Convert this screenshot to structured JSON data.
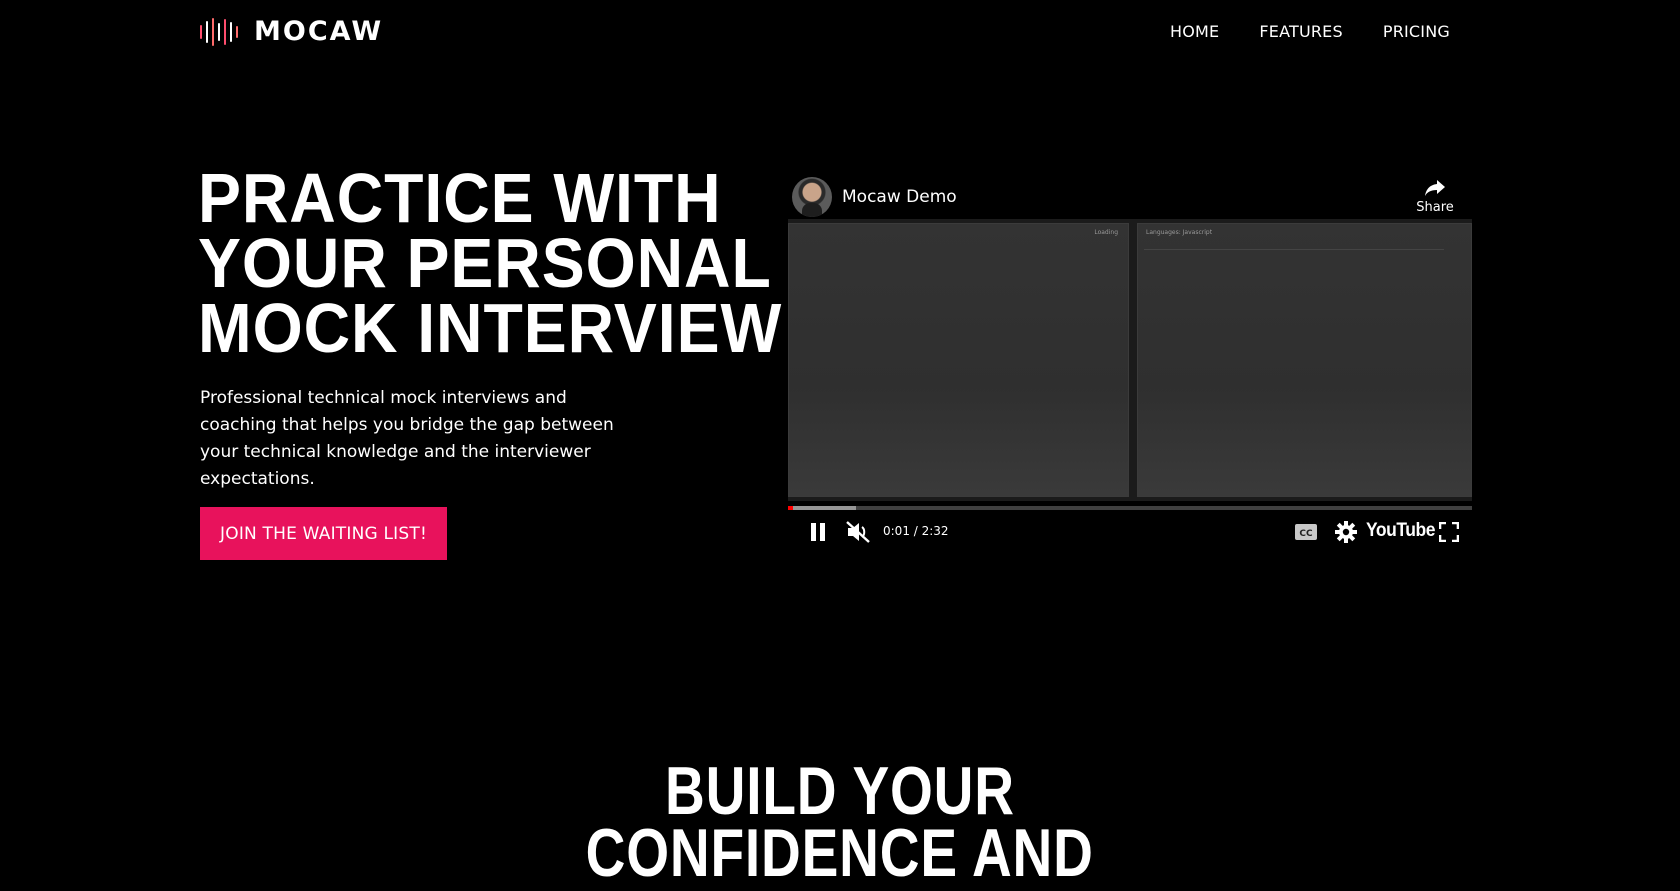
{
  "brand": {
    "name": "MOCAW",
    "bar_colors": [
      "#ff4d6d",
      "#ffffff",
      "#ff6b6b",
      "#ffffff",
      "#ff4d6d",
      "#ffffff",
      "#ff6b6b"
    ]
  },
  "nav": {
    "items": [
      {
        "label": "HOME"
      },
      {
        "label": "FEATURES"
      },
      {
        "label": "PRICING"
      }
    ]
  },
  "hero": {
    "title_lines": [
      "PRACTICE WITH",
      "YOUR PERSONAL",
      "MOCK INTERVIEWER"
    ],
    "subtitle": "Professional technical mock interviews and coaching that helps you bridge the gap between your technical knowledge and the interviewer expectations.",
    "cta_label": "JOIN THE WAITING LIST!",
    "accent_color": "#e8125c"
  },
  "video": {
    "title": "Mocaw Demo",
    "share_label": "Share",
    "time": "0:01 / 2:32",
    "played_fraction": 0.007,
    "loaded_fraction": 0.1,
    "player_logo": "YouTube",
    "pane_left_note": "Loading",
    "pane_right_note": "Languages:  Javascript",
    "icons": {
      "share": "share-arrow-icon",
      "play_pause": "pause-icon",
      "mute": "volume-muted-icon",
      "captions": "captions-icon",
      "settings": "gear-icon",
      "fullscreen": "fullscreen-icon"
    }
  },
  "section2": {
    "title_lines": [
      "BUILD YOUR",
      "CONFIDENCE AND"
    ]
  }
}
